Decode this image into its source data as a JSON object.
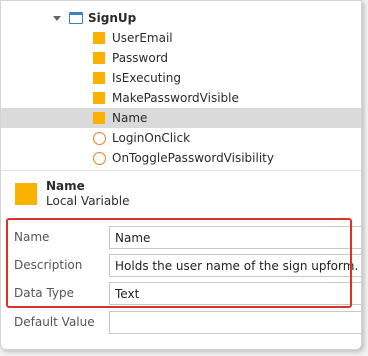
{
  "tree": {
    "parent": {
      "label": "SignUp",
      "icon": "screen-icon"
    },
    "items": [
      {
        "label": "UserEmail",
        "icon": "local-variable-icon"
      },
      {
        "label": "Password",
        "icon": "local-variable-icon"
      },
      {
        "label": "IsExecuting",
        "icon": "local-variable-icon"
      },
      {
        "label": "MakePasswordVisible",
        "icon": "local-variable-icon"
      },
      {
        "label": "Name",
        "icon": "local-variable-icon",
        "selected": true
      },
      {
        "label": "LoginOnClick",
        "icon": "screen-action-icon"
      },
      {
        "label": "OnTogglePasswordVisibility",
        "icon": "screen-action-icon"
      }
    ]
  },
  "element": {
    "name": "Name",
    "type": "Local Variable"
  },
  "properties": {
    "name": {
      "label": "Name",
      "value": "Name"
    },
    "description": {
      "label": "Description",
      "value": "Holds the user name of the sign upform."
    },
    "data_type": {
      "label": "Data Type",
      "value": "Text"
    },
    "default_value": {
      "label": "Default Value",
      "value": ""
    }
  },
  "colors": {
    "variable": "#fbb100",
    "action": "#ef7d22",
    "screen": "#3a82c4",
    "highlight": "#d9332a",
    "selection": "#dadada"
  }
}
